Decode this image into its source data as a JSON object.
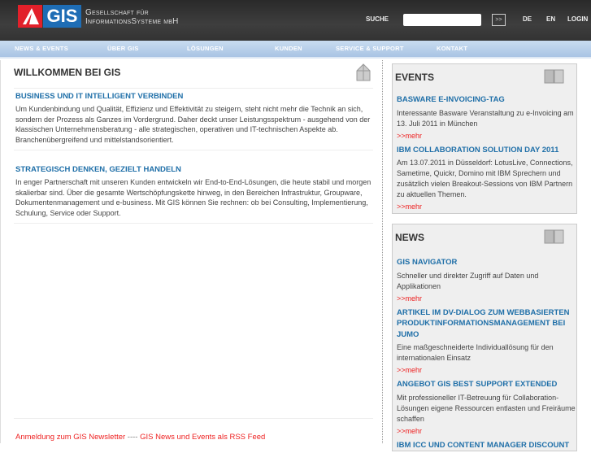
{
  "header": {
    "logo": "GIS",
    "company_line1": "Gesellschaft für",
    "company_line2": "InformationsSysteme mbH",
    "search_label": "SUCHE",
    "search_value": "",
    "search_button": ">>",
    "lang_de": "DE",
    "lang_en": "EN",
    "login": "LOGIN"
  },
  "nav": [
    "NEWS & EVENTS",
    "ÜBER GIS",
    "LÖSUNGEN",
    "KUNDEN",
    "SERVICE & SUPPORT",
    "KONTAKT"
  ],
  "main": {
    "title": "WILLKOMMEN BEI GIS",
    "sections": [
      {
        "title": "BUSINESS UND IT INTELLIGENT VERBINDEN",
        "body": "Um Kundenbindung und Qualität, Effizienz und Effektivität zu steigern, steht nicht mehr die Technik an sich, sondern der Prozess als Ganzes im Vordergrund. Daher deckt unser Leistungsspektrum - ausgehend von der klassischen Unternehmensberatung - alle strategischen, operativen und IT-technischen Aspekte ab. Branchenübergreifend und mittelstandsorientiert."
      },
      {
        "title": "STRATEGISCH DENKEN, GEZIELT HANDELN",
        "body": "In enger Partnerschaft mit unseren Kunden entwickeln wir End-to-End-Lösungen, die heute stabil und morgen skalierbar sind. Über die gesamte Wertschöpfungskette hinweg, in den Bereichen Infrastruktur, Groupware, Dokumentenmanagement und e-business. Mit GIS können Sie rechnen: ob bei Consulting, Implementierung, Schulung, Service oder Support."
      }
    ],
    "newsletter_link": "Anmeldung zum GIS Newsletter",
    "separator": " ---- ",
    "rss_link": "GIS News und Events als RSS Feed"
  },
  "events": {
    "title": "EVENTS",
    "items": [
      {
        "title": "BASWARE E-INVOICING-TAG",
        "body": "Interessante Basware Veranstaltung zu e-Invoicing am 13. Juli 2011 in München",
        "more": ">>mehr"
      },
      {
        "title": "IBM COLLABORATION SOLUTION DAY 2011",
        "body": "Am 13.07.2011 in Düsseldorf: LotusLive, Connections, Sametime, Quickr, Domino mit IBM Sprechern und zusätzlich vielen Breakout-Sessions von IBM Partnern zu aktuellen Themen.",
        "more": ">>mehr"
      }
    ]
  },
  "news": {
    "title": "NEWS",
    "items": [
      {
        "title": "GIS NAVIGATOR",
        "body": "Schneller und direkter Zugriff auf Daten und Applikationen",
        "more": ">>mehr"
      },
      {
        "title": "ARTIKEL IM DV-DIALOG ZUM WEBBASIERTEN PRODUKTINFORMATIONSMANAGEMENT BEI JUMO",
        "body": "Eine maßgeschneiderte Individuallösung für den internationalen Einsatz",
        "more": ">>mehr"
      },
      {
        "title": "ANGEBOT GIS BEST SUPPORT EXTENDED",
        "body": "Mit professioneller IT-Betreuung für Collaboration-Lösungen eigene Ressourcen entlasten und Freiräume schaffen",
        "more": ">>mehr"
      },
      {
        "title": "IBM ICC UND CONTENT MANAGER DISCOUNT"
      }
    ]
  }
}
